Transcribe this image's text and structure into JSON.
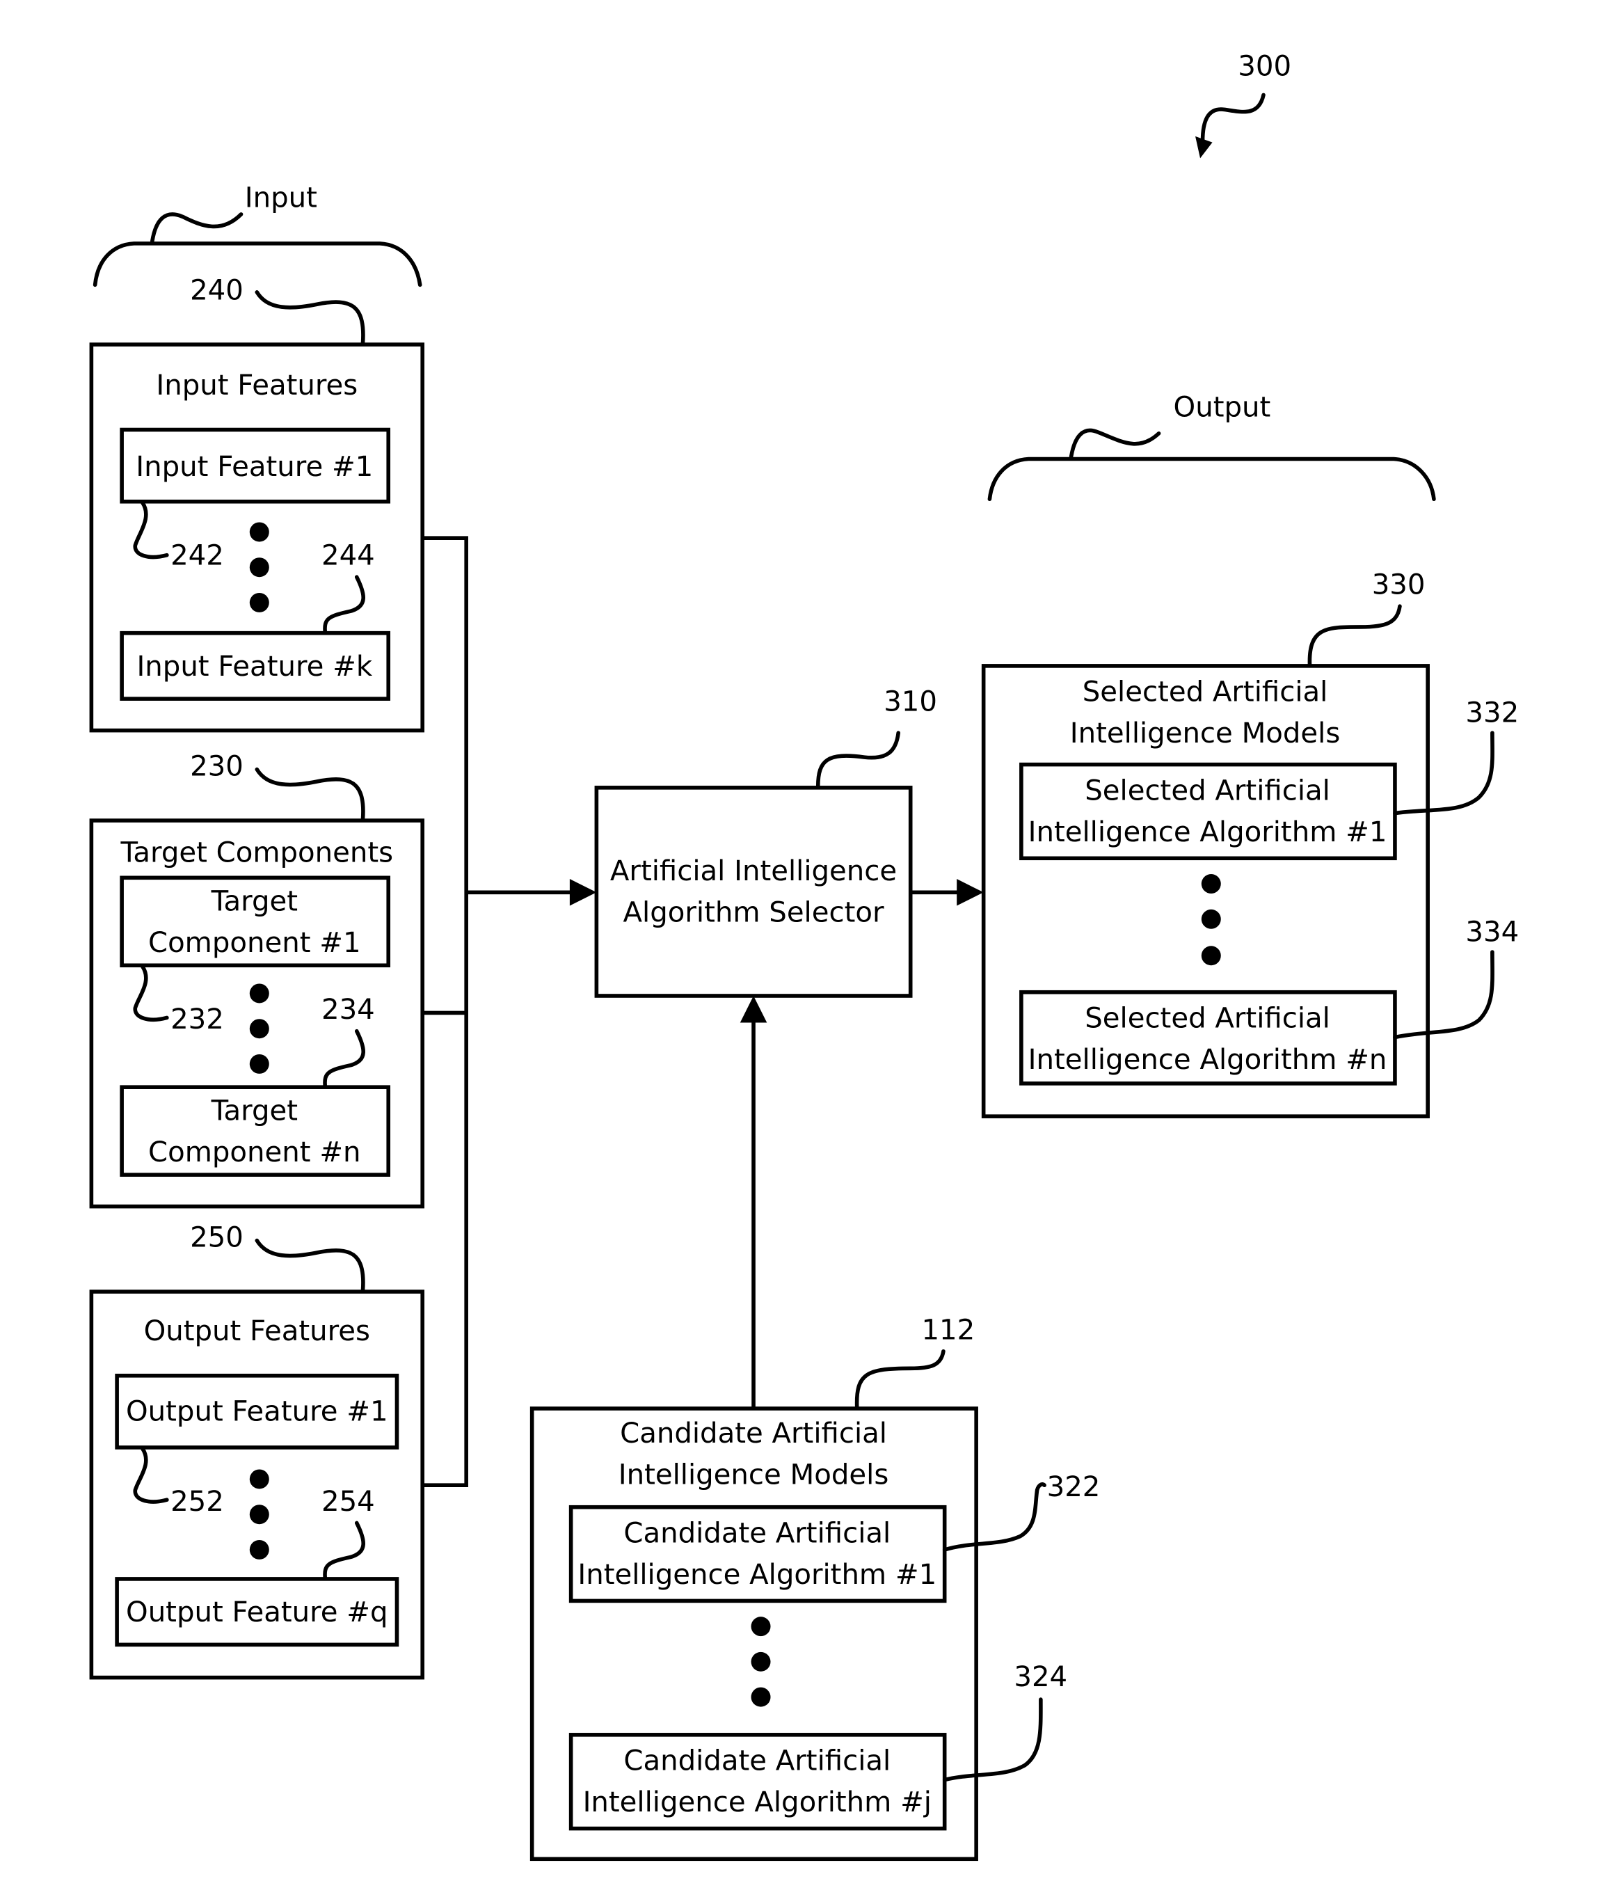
{
  "figure": {
    "reference": "300",
    "input_group_label": "Input",
    "output_group_label": "Output"
  },
  "input_features": {
    "reference": "240",
    "title": "Input Features",
    "first": {
      "label": "Input Feature #1",
      "reference": "242"
    },
    "last": {
      "label": "Input Feature #k",
      "reference": "244"
    }
  },
  "target_components": {
    "reference": "230",
    "title": "Target Components",
    "first": {
      "label_line1": "Target",
      "label_line2": "Component #1",
      "reference": "232"
    },
    "last": {
      "label_line1": "Target",
      "label_line2": "Component #n",
      "reference": "234"
    }
  },
  "output_features": {
    "reference": "250",
    "title": "Output Features",
    "first": {
      "label": "Output Feature #1",
      "reference": "252"
    },
    "last": {
      "label": "Output Feature #q",
      "reference": "254"
    }
  },
  "selector": {
    "reference": "310",
    "label_line1": "Artificial Intelligence",
    "label_line2": "Algorithm Selector"
  },
  "selected_models": {
    "reference": "330",
    "title_line1": "Selected Artificial",
    "title_line2": "Intelligence Models",
    "first": {
      "label_line1": "Selected Artificial",
      "label_line2": "Intelligence Algorithm #1",
      "reference": "332"
    },
    "last": {
      "label_line1": "Selected Artificial",
      "label_line2": "Intelligence Algorithm #n",
      "reference": "334"
    }
  },
  "candidate_models": {
    "reference": "112",
    "title_line1": "Candidate Artificial",
    "title_line2": "Intelligence Models",
    "first": {
      "label_line1": "Candidate Artificial",
      "label_line2": "Intelligence Algorithm #1",
      "reference": "322"
    },
    "last": {
      "label_line1": "Candidate Artificial",
      "label_line2": "Intelligence Algorithm #j",
      "reference": "324"
    }
  }
}
